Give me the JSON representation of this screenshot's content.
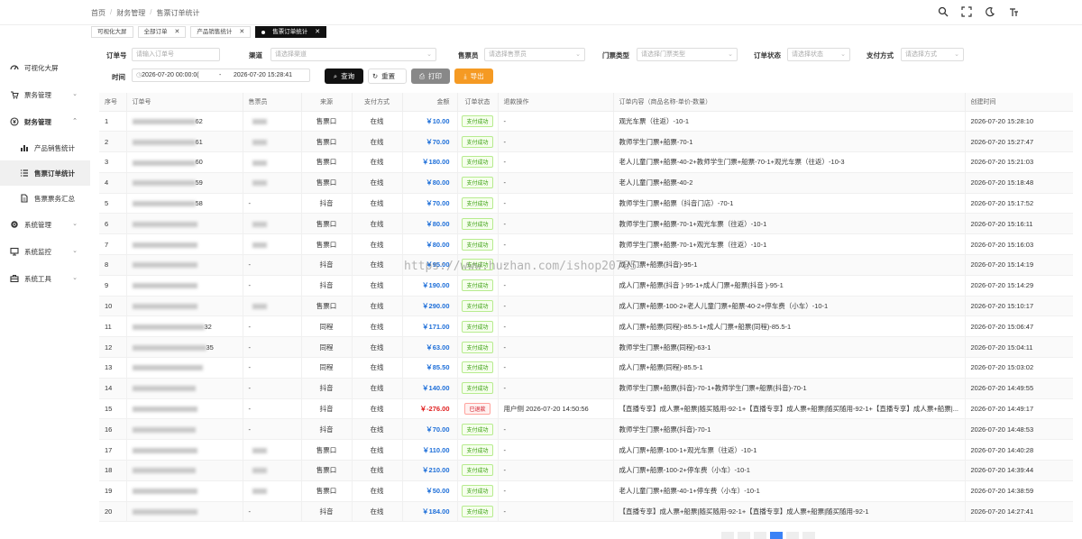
{
  "breadcrumb": [
    "首页",
    "财务管理",
    "售票订单统计"
  ],
  "tabs": [
    {
      "label": "可视化大屏",
      "closable": false,
      "active": false
    },
    {
      "label": "全部订单",
      "closable": true,
      "active": false
    },
    {
      "label": "产品销售统计",
      "closable": true,
      "active": false
    },
    {
      "label": "售票订单统计",
      "closable": true,
      "active": true
    }
  ],
  "sidebar": [
    {
      "label": "可视化大屏",
      "icon": "dashboard-icon"
    },
    {
      "label": "票务管理",
      "icon": "cart-icon",
      "arrow": "chevron-down"
    },
    {
      "label": "财务管理",
      "icon": "money-icon",
      "arrow": "chevron-up"
    },
    {
      "label": "产品销售统计",
      "icon": "bar-chart-icon",
      "sub": true
    },
    {
      "label": "售票订单统计",
      "icon": "list-icon",
      "sub": true,
      "active": true
    },
    {
      "label": "售票票务汇总",
      "icon": "doc-icon",
      "sub": true
    },
    {
      "label": "系统管理",
      "icon": "gear-icon",
      "arrow": "chevron-down"
    },
    {
      "label": "系统监控",
      "icon": "monitor-icon",
      "arrow": "chevron-down"
    },
    {
      "label": "系统工具",
      "icon": "toolbox-icon",
      "arrow": "chevron-down"
    }
  ],
  "filters": {
    "order_no": {
      "label": "订单号",
      "placeholder": "请输入订单号"
    },
    "channel": {
      "label": "渠道",
      "placeholder": "请选择渠道"
    },
    "seller": {
      "label": "售票员",
      "placeholder": "请选择售票员"
    },
    "ticket_type": {
      "label": "门票类型",
      "placeholder": "请选择门票类型"
    },
    "status": {
      "label": "订单状态",
      "placeholder": "请选择状态"
    },
    "pay": {
      "label": "支付方式",
      "placeholder": "请选择方式"
    },
    "time": {
      "label": "时间",
      "start": "2026-07-20 00:00:0(",
      "sep": "-",
      "end": "2026-07-20 15:28:41"
    }
  },
  "buttons": {
    "query": "查询",
    "reset": "重置",
    "print": "打印",
    "export": "导出"
  },
  "columns": [
    "序号",
    "订单号",
    "售票员",
    "来源",
    "支付方式",
    "金额",
    "订单状态",
    "退款操作",
    "订单内容（商品名称-单价-数量）",
    "创建时间"
  ],
  "rows": [
    {
      "no": "1",
      "order_tail": "62",
      "seller": "blur",
      "source": "售票口",
      "pay": "在线",
      "amount": "￥10.00",
      "status": "支付成功",
      "refund": "-",
      "content": "观光车票（往返）-10-1",
      "time": "2026-07-20 15:28:10"
    },
    {
      "no": "2",
      "order_tail": "61",
      "seller": "blur",
      "source": "售票口",
      "pay": "在线",
      "amount": "￥70.00",
      "status": "支付成功",
      "refund": "-",
      "content": "教师学生门票+船票-70-1",
      "time": "2026-07-20 15:27:47"
    },
    {
      "no": "3",
      "order_tail": "60",
      "seller": "blur",
      "source": "售票口",
      "pay": "在线",
      "amount": "￥180.00",
      "status": "支付成功",
      "refund": "-",
      "content": "老人儿童门票+船票-40-2+教师学生门票+船票-70-1+观光车票（往返）-10-3",
      "time": "2026-07-20 15:21:03"
    },
    {
      "no": "4",
      "order_tail": "59",
      "seller": "blur",
      "source": "售票口",
      "pay": "在线",
      "amount": "￥80.00",
      "status": "支付成功",
      "refund": "-",
      "content": "老人儿童门票+船票-40-2",
      "time": "2026-07-20 15:18:48"
    },
    {
      "no": "5",
      "order_tail": "58",
      "seller": "-",
      "source": "抖音",
      "pay": "在线",
      "amount": "￥70.00",
      "status": "支付成功",
      "refund": "-",
      "content": "教师学生门票+船票（抖音门店）-70-1",
      "time": "2026-07-20 15:17:52"
    },
    {
      "no": "6",
      "order_tail": "",
      "seller": "blur",
      "source": "售票口",
      "pay": "在线",
      "amount": "￥80.00",
      "status": "支付成功",
      "refund": "-",
      "content": "教师学生门票+船票-70-1+观光车票（往返）-10-1",
      "time": "2026-07-20 15:16:11"
    },
    {
      "no": "7",
      "order_tail": "",
      "seller": "blur",
      "source": "售票口",
      "pay": "在线",
      "amount": "￥80.00",
      "status": "支付成功",
      "refund": "-",
      "content": "教师学生门票+船票-70-1+观光车票（往返）-10-1",
      "time": "2026-07-20 15:16:03"
    },
    {
      "no": "8",
      "order_tail": "",
      "seller": "-",
      "source": "抖音",
      "pay": "在线",
      "amount": "￥95.00",
      "status": "支付成功",
      "refund": "-",
      "content": "成人门票+船票(抖音)-95-1",
      "time": "2026-07-20 15:14:19"
    },
    {
      "no": "9",
      "order_tail": "",
      "seller": "-",
      "source": "抖音",
      "pay": "在线",
      "amount": "￥190.00",
      "status": "支付成功",
      "refund": "-",
      "content": "成人门票+船票(抖音 )-95-1+成人门票+船票(抖音 )-95-1",
      "time": "2026-07-20 15:14:29"
    },
    {
      "no": "10",
      "order_tail": "",
      "seller": "blur",
      "source": "售票口",
      "pay": "在线",
      "amount": "￥290.00",
      "status": "支付成功",
      "refund": "-",
      "content": "成人门票+船票-100-2+老人儿童门票+船票-40-2+停车费（小车）-10-1",
      "time": "2026-07-20 15:10:17"
    },
    {
      "no": "11",
      "order_tail": "32",
      "seller": "-",
      "source": "同程",
      "pay": "在线",
      "amount": "￥171.00",
      "status": "支付成功",
      "refund": "-",
      "content": "成人门票+船票(同程)-85.5-1+成人门票+船票(同程)-85.5-1",
      "time": "2026-07-20 15:06:47"
    },
    {
      "no": "12",
      "order_tail": "35",
      "seller": "-",
      "source": "同程",
      "pay": "在线",
      "amount": "￥63.00",
      "status": "支付成功",
      "refund": "-",
      "content": "教师学生门票+船票(同程)-63-1",
      "time": "2026-07-20 15:04:11"
    },
    {
      "no": "13",
      "order_tail": "",
      "seller": "-",
      "source": "同程",
      "pay": "在线",
      "amount": "￥85.50",
      "status": "支付成功",
      "refund": "-",
      "content": "成人门票+船票(同程)-85.5-1",
      "time": "2026-07-20 15:03:02"
    },
    {
      "no": "14",
      "order_tail": "",
      "seller": "-",
      "source": "抖音",
      "pay": "在线",
      "amount": "￥140.00",
      "status": "支付成功",
      "refund": "-",
      "content": "教师学生门票+船票(抖音)-70-1+教师学生门票+船票(抖音)-70-1",
      "time": "2026-07-20 14:49:55"
    },
    {
      "no": "15",
      "order_tail": "",
      "seller": "-",
      "source": "抖音",
      "pay": "在线",
      "amount": "￥-276.00",
      "status": "已退款",
      "refund": "用户侧 2026-07-20 14:50:56",
      "content": "【直播专享】成人票+船票|随买随用-92-1+【直播专享】成人票+船票|随买随用-92-1+【直播专享】成人票+船票|...",
      "time": "2026-07-20 14:49:17"
    },
    {
      "no": "16",
      "order_tail": "",
      "seller": "-",
      "source": "抖音",
      "pay": "在线",
      "amount": "￥70.00",
      "status": "支付成功",
      "refund": "-",
      "content": "教师学生门票+船票(抖音)-70-1",
      "time": "2026-07-20 14:48:53"
    },
    {
      "no": "17",
      "order_tail": "",
      "seller": "blur",
      "source": "售票口",
      "pay": "在线",
      "amount": "￥110.00",
      "status": "支付成功",
      "refund": "-",
      "content": "成人门票+船票-100-1+观光车票（往返）-10-1",
      "time": "2026-07-20 14:40:28"
    },
    {
      "no": "18",
      "order_tail": "",
      "seller": "blur",
      "source": "售票口",
      "pay": "在线",
      "amount": "￥210.00",
      "status": "支付成功",
      "refund": "-",
      "content": "成人门票+船票-100-2+停车费（小车）-10-1",
      "time": "2026-07-20 14:39:44"
    },
    {
      "no": "19",
      "order_tail": "",
      "seller": "blur",
      "source": "售票口",
      "pay": "在线",
      "amount": "￥50.00",
      "status": "支付成功",
      "refund": "-",
      "content": "老人儿童门票+船票-40-1+停车费（小车）-10-1",
      "time": "2026-07-20 14:38:59"
    },
    {
      "no": "20",
      "order_tail": "",
      "seller": "-",
      "source": "抖音",
      "pay": "在线",
      "amount": "￥184.00",
      "status": "支付成功",
      "refund": "-",
      "content": "【直播专享】成人票+船票|随买随用-92-1+【直播专享】成人票+船票|随买随用-92-1",
      "time": "2026-07-20 14:27:41"
    }
  ],
  "watermark": "https://www.huzhan.com/ishop20785",
  "colors": {
    "accent": "#111111",
    "amount": "#1e6fd9",
    "refund": "#e02020",
    "export": "#f59a23"
  }
}
